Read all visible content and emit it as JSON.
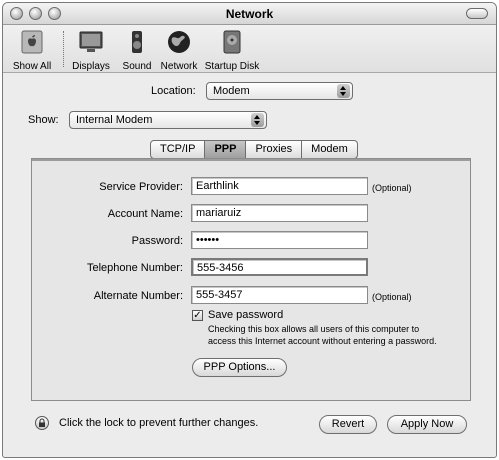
{
  "window": {
    "title": "Network"
  },
  "toolbar": {
    "items": [
      {
        "label": "Show All",
        "icon": "apple-icon"
      },
      {
        "label": "Displays",
        "icon": "display-icon"
      },
      {
        "label": "Sound",
        "icon": "speaker-icon"
      },
      {
        "label": "Network",
        "icon": "globe-icon"
      },
      {
        "label": "Startup Disk",
        "icon": "disk-icon"
      }
    ]
  },
  "location": {
    "label": "Location:",
    "value": "Modem"
  },
  "show": {
    "label": "Show:",
    "value": "Internal Modem"
  },
  "tabs": [
    {
      "label": "TCP/IP"
    },
    {
      "label": "PPP",
      "selected": true
    },
    {
      "label": "Proxies"
    },
    {
      "label": "Modem"
    }
  ],
  "ppp": {
    "service_provider": {
      "label": "Service Provider:",
      "value": "Earthlink",
      "note": "(Optional)"
    },
    "account_name": {
      "label": "Account Name:",
      "value": "mariaruiz"
    },
    "password": {
      "label": "Password:",
      "value": "••••••"
    },
    "telephone_number": {
      "label": "Telephone Number:",
      "value": "555-3456"
    },
    "alternate_number": {
      "label": "Alternate Number:",
      "value": "555-3457",
      "note": "(Optional)"
    },
    "save_password": {
      "label": "Save password",
      "checked": true,
      "check_glyph": "✓",
      "help_line1": "Checking this box allows all users of this computer to",
      "help_line2": "access this Internet account without entering a password."
    },
    "options_button": "PPP Options..."
  },
  "footer": {
    "lock_text": "Click the lock to prevent further changes.",
    "revert_label": "Revert",
    "apply_label": "Apply Now"
  }
}
